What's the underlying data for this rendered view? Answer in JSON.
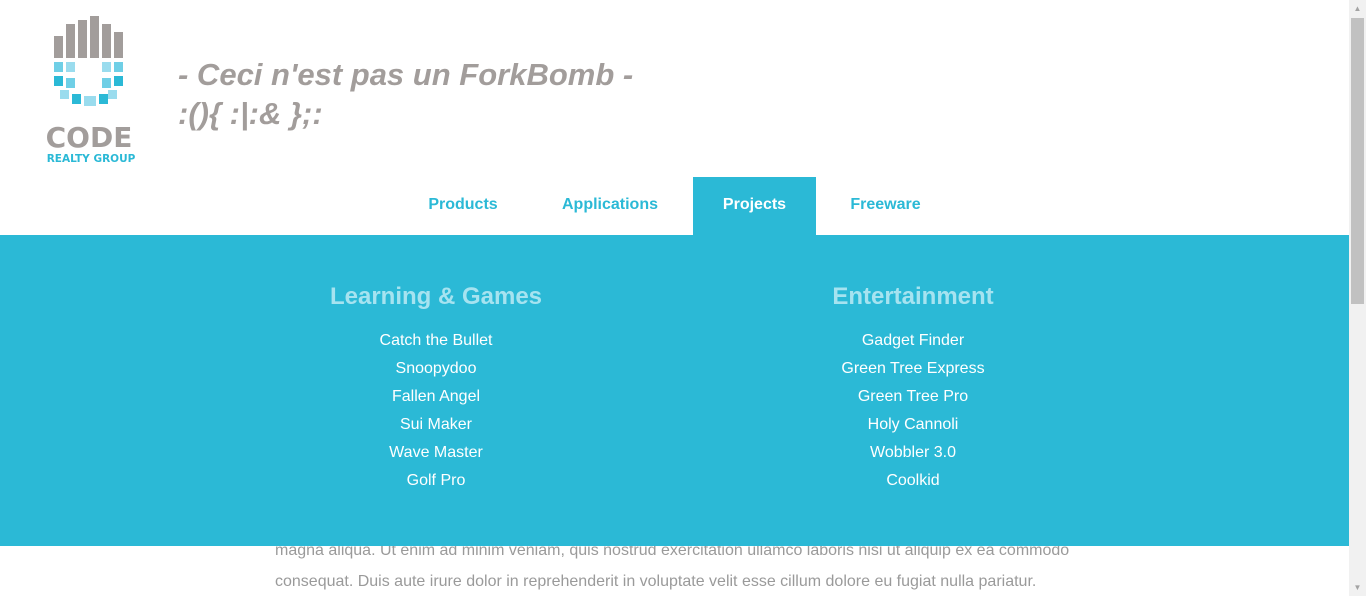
{
  "brand": {
    "logo_word": "CODE",
    "logo_sub": "REALTY GROUP",
    "colors": {
      "gray": "#a29d9b",
      "blue": "#2bb9d6",
      "light_blue": "#6fcfe6"
    }
  },
  "tagline": {
    "line1": "- Ceci n'est pas un ForkBomb -",
    "line2": ":(){ :|:& };:"
  },
  "nav": {
    "items": [
      {
        "label": "Products"
      },
      {
        "label": "Applications"
      },
      {
        "label": "Projects",
        "active": true
      },
      {
        "label": "Freeware"
      }
    ]
  },
  "mega_menu": {
    "columns": [
      {
        "title": "Learning & Games",
        "items": [
          "Catch the Bullet",
          "Snoopydoo",
          "Fallen Angel",
          "Sui Maker",
          "Wave Master",
          "Golf Pro"
        ]
      },
      {
        "title": "Entertainment",
        "items": [
          "Gadget Finder",
          "Green Tree Express",
          "Green Tree Pro",
          "Holy Cannoli",
          "Wobbler 3.0",
          "Coolkid"
        ]
      }
    ]
  },
  "body_text": {
    "line1": "magna aliqua. Ut enim ad minim veniam, quis nostrud exercitation ullamco laboris nisi ut aliquip ex ea commodo",
    "line2": "consequat. Duis aute irure dolor in reprehenderit in voluptate velit esse cillum dolore eu fugiat nulla pariatur."
  }
}
